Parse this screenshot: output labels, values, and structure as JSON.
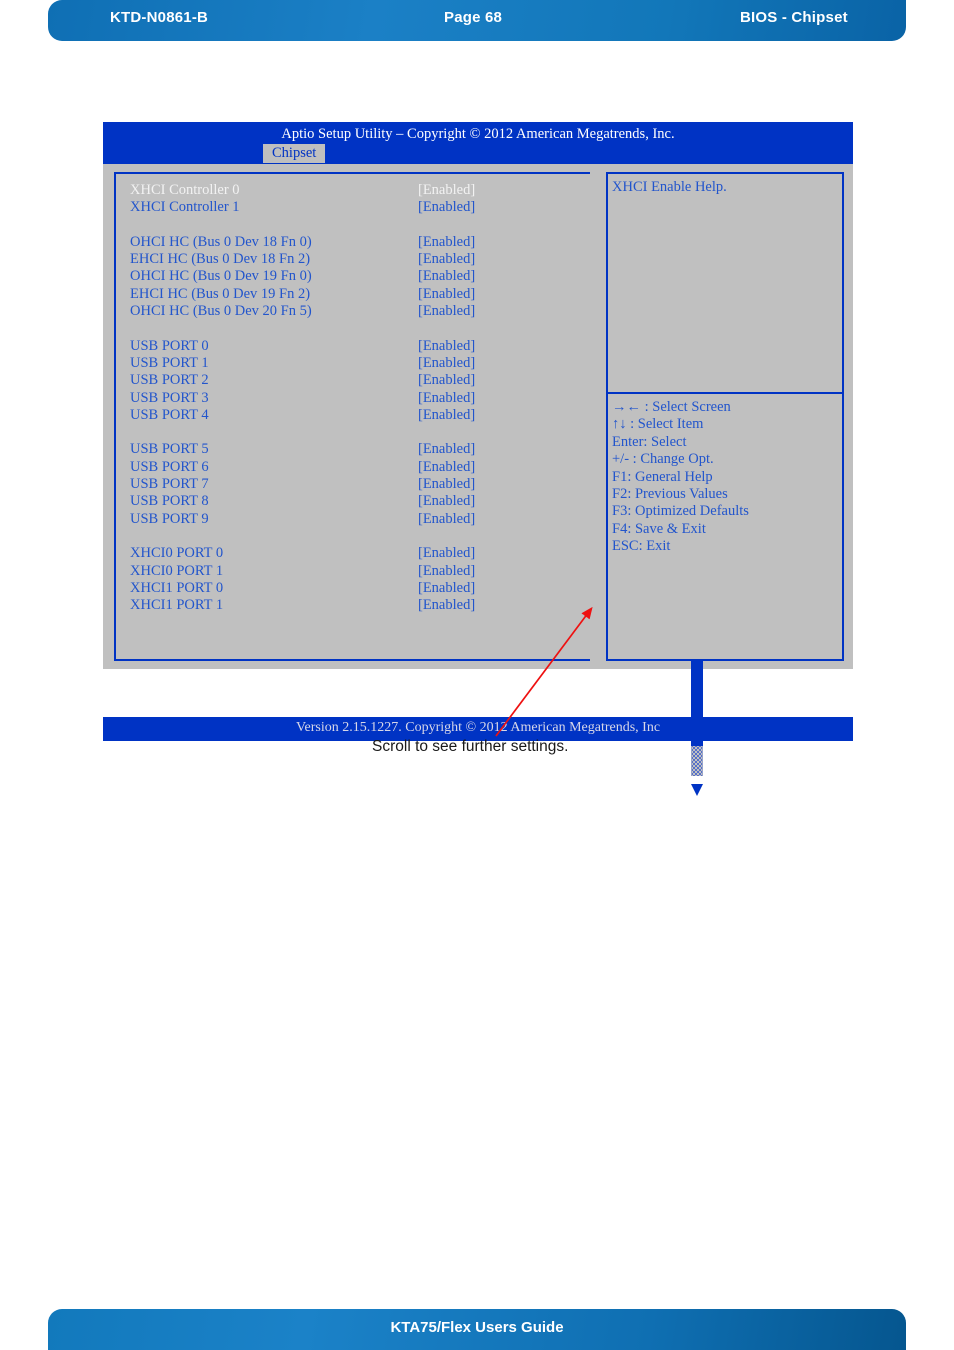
{
  "page_header": {
    "doc_id": "KTD-N0861-B",
    "page_label": "Page 68",
    "section": "BIOS  - Chipset"
  },
  "page_footer": {
    "guide_title": "KTA75/Flex Users Guide"
  },
  "bios": {
    "title": "Aptio Setup Utility  –  Copyright © 2012 American Megatrends, Inc.",
    "active_tab": "Chipset",
    "version_bar": "Version 2.15.1227. Copyright © 2012 American Megatrends, Inc",
    "help": {
      "text": "XHCI Enable Help."
    },
    "keys": [
      "→← : Select Screen",
      "↑↓ : Select Item",
      "Enter: Select",
      "+/- : Change Opt.",
      "F1: General Help",
      "F2: Previous Values",
      "F3: Optimized Defaults",
      "F4: Save & Exit",
      "ESC: Exit"
    ],
    "rows": [
      {
        "label": "XHCI Controller 0",
        "value": "[Enabled]",
        "selected": true
      },
      {
        "label": "XHCI Controller 1",
        "value": "[Enabled]",
        "selected": false
      },
      {
        "spacer": true
      },
      {
        "label": "OHCI HC (Bus 0 Dev 18 Fn 0)",
        "value": "[Enabled]",
        "selected": false
      },
      {
        "label": "EHCI HC (Bus 0 Dev 18 Fn 2)",
        "value": "[Enabled]",
        "selected": false
      },
      {
        "label": "OHCI HC (Bus 0 Dev 19 Fn 0)",
        "value": "[Enabled]",
        "selected": false
      },
      {
        "label": "EHCI HC (Bus 0 Dev 19 Fn 2)",
        "value": "[Enabled]",
        "selected": false
      },
      {
        "label": "OHCI HC (Bus 0 Dev 20 Fn 5)",
        "value": "[Enabled]",
        "selected": false
      },
      {
        "spacer": true
      },
      {
        "label": "USB PORT 0",
        "value": "[Enabled]",
        "selected": false
      },
      {
        "label": "USB PORT 1",
        "value": "[Enabled]",
        "selected": false
      },
      {
        "label": "USB PORT 2",
        "value": "[Enabled]",
        "selected": false
      },
      {
        "label": "USB PORT 3",
        "value": "[Enabled]",
        "selected": false
      },
      {
        "label": "USB PORT 4",
        "value": "[Enabled]",
        "selected": false
      },
      {
        "spacer": true
      },
      {
        "label": "USB PORT 5",
        "value": "[Enabled]",
        "selected": false
      },
      {
        "label": "USB PORT 6",
        "value": "[Enabled]",
        "selected": false
      },
      {
        "label": "USB PORT 7",
        "value": "[Enabled]",
        "selected": false
      },
      {
        "label": "USB PORT 8",
        "value": "[Enabled]",
        "selected": false
      },
      {
        "label": "USB PORT 9",
        "value": "[Enabled]",
        "selected": false
      },
      {
        "spacer": true
      },
      {
        "label": "XHCI0 PORT 0",
        "value": "[Enabled]",
        "selected": false
      },
      {
        "label": "XHCI0 PORT 1",
        "value": "[Enabled]",
        "selected": false
      },
      {
        "label": "XHCI1 PORT 0",
        "value": "[Enabled]",
        "selected": false
      },
      {
        "label": "XHCI1 PORT 1",
        "value": "[Enabled]",
        "selected": false
      }
    ]
  },
  "annotation": {
    "text": "Scroll to see further settings.",
    "arrow_color": "#ee1111"
  },
  "colors": {
    "bios_blue": "#0033c4",
    "bios_gray": "#c0c0c0",
    "bios_text_blue": "#2255cc",
    "header_blue": "#1277b9",
    "accent_red": "#ee1111"
  }
}
